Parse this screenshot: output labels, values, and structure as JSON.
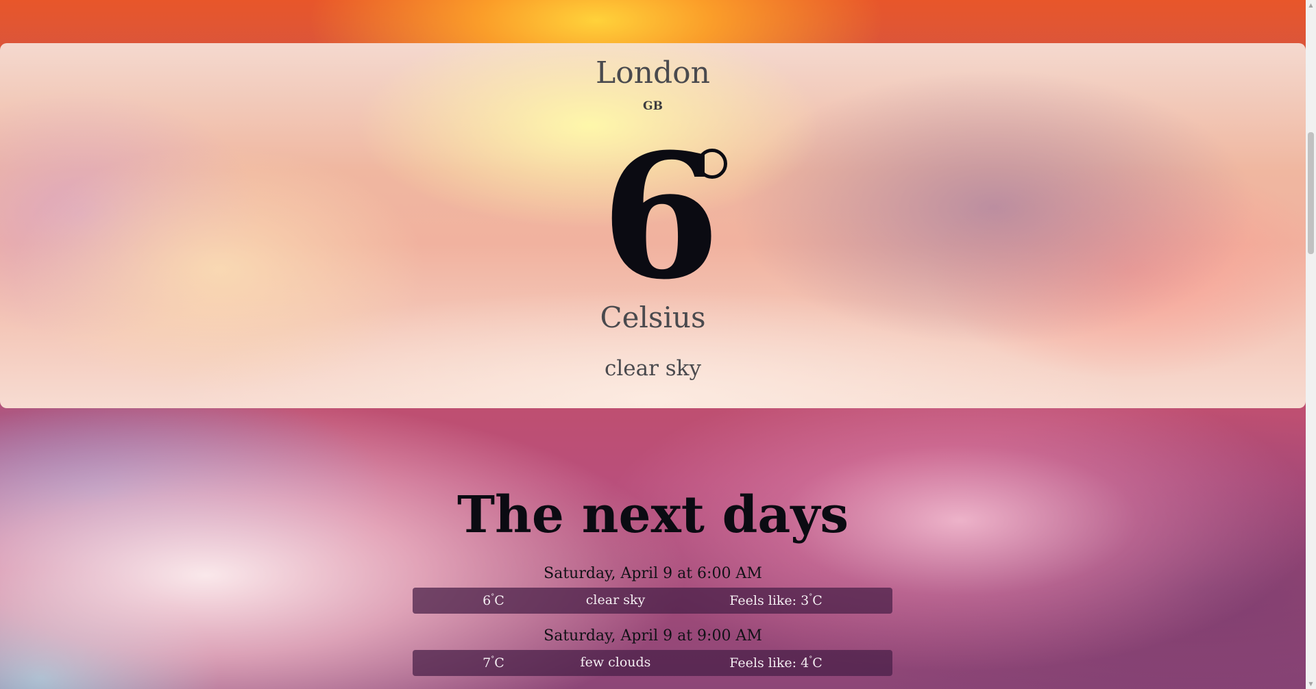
{
  "current": {
    "city": "London",
    "country": "GB",
    "temperature": "6",
    "unit": "Celsius",
    "description": "clear sky"
  },
  "next_days": {
    "title": "The next days",
    "forecasts": [
      {
        "date": "Saturday, April 9 at 6:00 AM",
        "temp": "6",
        "temp_unit": "C",
        "description": "clear sky",
        "feels_label": "Feels like: ",
        "feels": "3",
        "feels_unit": "C"
      },
      {
        "date": "Saturday, April 9 at 9:00 AM",
        "temp": "7",
        "temp_unit": "C",
        "description": "few clouds",
        "feels_label": "Feels like: ",
        "feels": "4",
        "feels_unit": "C"
      }
    ]
  },
  "scrollbar": {
    "up_glyph": "▲",
    "down_glyph": "▼"
  }
}
